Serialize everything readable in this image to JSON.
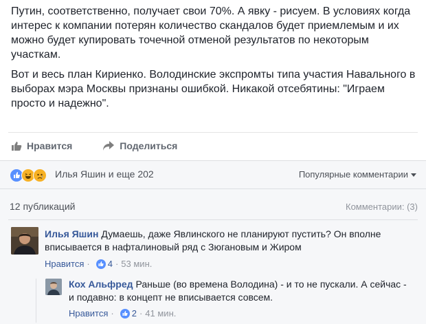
{
  "post": {
    "paragraph1": "Путин, соответственно, получает свои 70%. А явку - рисуем. В условиях когда интерес к компании потерян количество скандалов будет приемлемым и их можно будет купировать точечной отменой результатов по некоторым участкам.",
    "paragraph2": "Вот и весь план Кириенко. Володинские экспромты типа участия Навального в выборах мэра Москвы признаны ошибкой. Никакой отсебятины: \"Играем просто и надежно\"."
  },
  "actions": {
    "like_label": "Нравится",
    "share_label": "Поделиться"
  },
  "reactions": {
    "summary": "Илья Яшин и еще 202",
    "icons": [
      "like-reaction-icon",
      "haha-reaction-icon",
      "sad-reaction-icon"
    ],
    "colors": {
      "like": "#5890ff",
      "haha": "#f7b125",
      "sad": "#f7b125"
    }
  },
  "sort": {
    "label": "Популярные комментарии"
  },
  "comments_header": {
    "publications": "12 публикаций",
    "comments_count": "Комментарии: (3)"
  },
  "comments": [
    {
      "author": "Илья Яшин",
      "text": "Думаешь, даже Явлинского не планируют пустить? Он вполне вписывается в нафталиновый ряд с Зюгановым и Жиром",
      "like_label": "Нравится",
      "likes": "4",
      "time": "53 мин."
    },
    {
      "author": "Кох Альфред",
      "text": "Раньше (во времена Володина) - и то не пускали. А сейчас - и подавно: в концепт не вписывается совсем.",
      "like_label": "Нравится",
      "likes": "2",
      "time": "41 мин."
    }
  ],
  "colors": {
    "link": "#365899",
    "muted": "#90949c",
    "background": "#e9ebee"
  }
}
